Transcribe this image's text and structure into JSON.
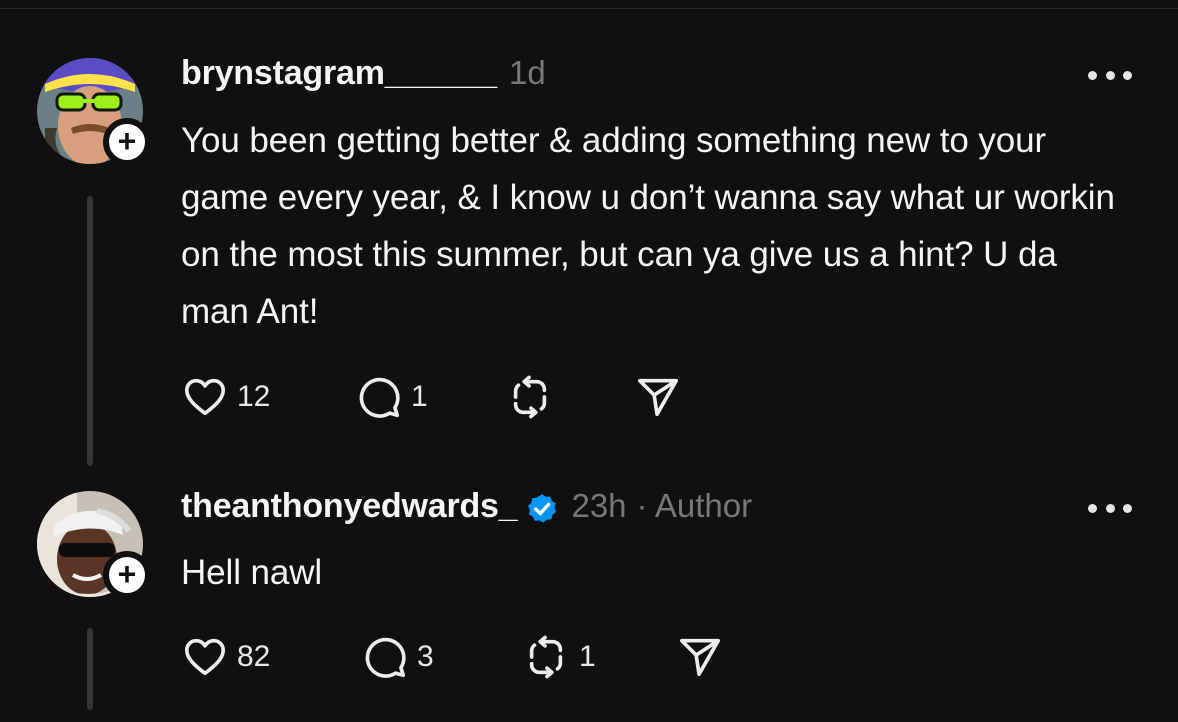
{
  "posts": [
    {
      "username": "brynstagram______",
      "time": "1d",
      "text": "You been getting better & adding something new to your game every year, & I know u don’t wanna say what ur workin on the most this summer, but can ya give us a hint? U da man Ant!",
      "likes": "12",
      "replies": "1",
      "reposts": "",
      "follow_symbol": "+"
    },
    {
      "username": "theanthonyedwards_",
      "verified": true,
      "time": "23h",
      "author_tag": "· Author",
      "text": "Hell nawl",
      "likes": "82",
      "replies": "3",
      "reposts": "1",
      "follow_symbol": "+"
    }
  ],
  "icons": {
    "like": "heart-icon",
    "reply": "comment-icon",
    "repost": "repost-icon",
    "share": "send-icon",
    "more": "more-icon",
    "verified": "verified-badge-icon"
  },
  "colors": {
    "background": "#101010",
    "text": "#f3f5f7",
    "muted": "#777777",
    "verified": "#0095f6",
    "thread_line": "#333638"
  }
}
